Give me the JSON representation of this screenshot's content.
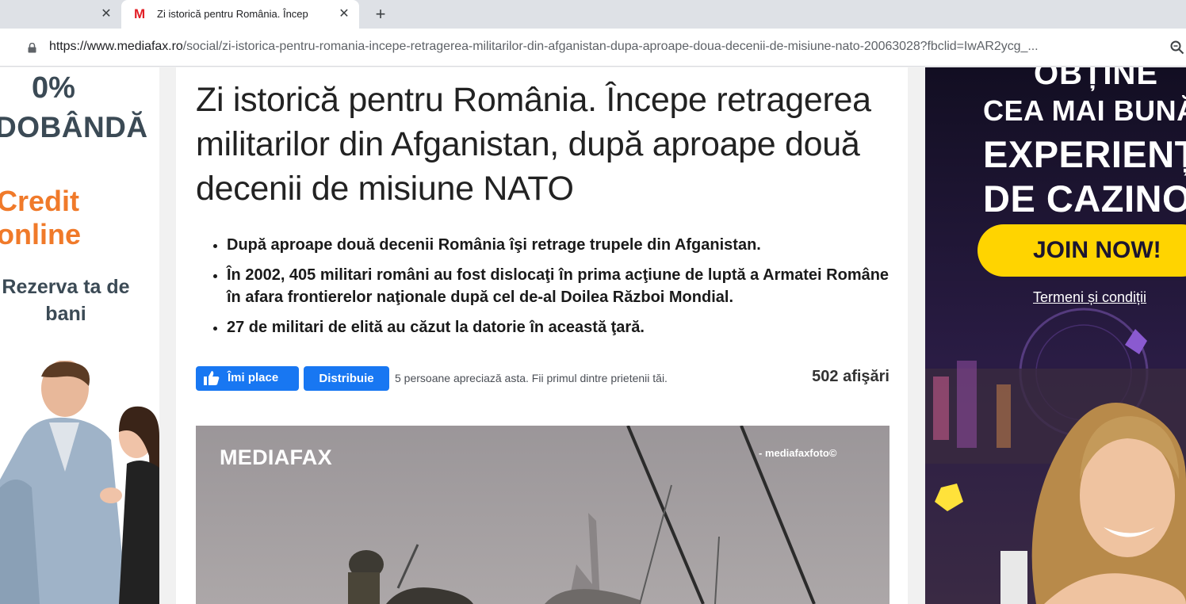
{
  "browser": {
    "tabs": [
      {
        "title": "",
        "active": false
      },
      {
        "title": "Zi istorică pentru România. Încep",
        "favicon": "M",
        "active": true
      }
    ],
    "url_host": "https://www.mediafax.ro",
    "url_path": "/social/zi-istorica-pentru-romania-incepe-retragerea-militarilor-din-afganistan-dupa-aproape-doua-decenii-de-misiune-nato-20063028?fbclid=IwAR2ycg_..."
  },
  "ad_left": {
    "line1": "0%",
    "line2": "DOBÂNDĂ",
    "line3": "Credit online",
    "line4": "Rezerva ta de bani"
  },
  "article": {
    "headline": "Zi istorică pentru România. Începe retragerea militarilor din Afganistan, după aproape două decenii de misiune NATO",
    "bullets": [
      "După aproape două decenii România îşi retrage trupele din Afganistan.",
      "În 2002, 405 militari români au fost dislocaţi în prima acţiune de luptă a Armatei Române în afara frontierelor naţionale după cel de-al Doilea Război Mondial.",
      "27 de militari de elită au căzut la datorie în această ţară."
    ],
    "social": {
      "like_label": "Îmi place",
      "share_label": "Distribuie",
      "likes_text": "5 persoane apreciază asta. Fii primul dintre prietenii tăi.",
      "views": "502 afişări"
    },
    "hero": {
      "logo": "MEDIAFAX",
      "credit": "- mediafaxfoto©"
    }
  },
  "ad_right": {
    "line1": "OBȚINE",
    "line2": "CEA MAI BUNĂ",
    "line3": "EXPERIENȚĂ",
    "line4": "DE CAZINO",
    "button": "JOIN NOW!",
    "terms": "Termeni și condiții"
  }
}
